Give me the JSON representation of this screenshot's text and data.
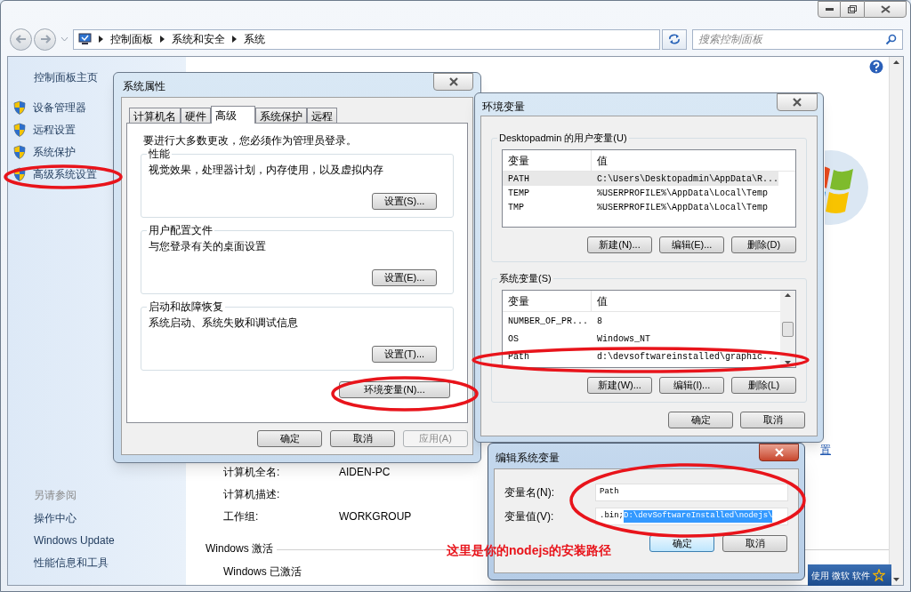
{
  "address_bar": {
    "crumbs": [
      "控制面板",
      "系统和安全",
      "系统"
    ]
  },
  "search": {
    "placeholder": "搜索控制面板"
  },
  "sidebar": {
    "home": "控制面板主页",
    "items": [
      "设备管理器",
      "远程设置",
      "系统保护",
      "高级系统设置"
    ],
    "see_also_title": "另请参阅",
    "see_also": [
      "操作中心",
      "Windows Update",
      "性能信息和工具"
    ]
  },
  "content": {
    "rows": [
      {
        "label": "计算机全名:",
        "value": "AIDEN-PC"
      },
      {
        "label": "计算机描述:"
      },
      {
        "label": "工作组:",
        "value": "WORKGROUP"
      }
    ],
    "activation": {
      "heading": "Windows 激活",
      "status": "Windows 已激活"
    },
    "partial_link": "置",
    "badge": [
      "使用",
      "微软",
      "软件"
    ]
  },
  "system_properties": {
    "title": "系统属性",
    "tabs": [
      {
        "label": "计算机名",
        "selected": false
      },
      {
        "label": "硬件",
        "selected": false
      },
      {
        "label": "高级",
        "selected": true
      },
      {
        "label": "系统保护",
        "selected": false
      },
      {
        "label": "远程",
        "selected": false
      }
    ],
    "notice": "要进行大多数更改，您必须作为管理员登录。",
    "groups": [
      {
        "title": "性能",
        "description": "视觉效果，处理器计划，内存使用，以及虚拟内存",
        "button": "设置(S)..."
      },
      {
        "title": "用户配置文件",
        "description": "与您登录有关的桌面设置",
        "button": "设置(E)..."
      },
      {
        "title": "启动和故障恢复",
        "description": "系统启动、系统失败和调试信息",
        "button": "设置(T)..."
      }
    ],
    "env_button": "环境变量(N)...",
    "buttons": [
      {
        "label": "确定",
        "disabled": false
      },
      {
        "label": "取消",
        "disabled": false
      },
      {
        "label": "应用(A)",
        "disabled": true
      }
    ]
  },
  "environment_variables": {
    "title": "环境变量",
    "user_group": {
      "title": "Desktopadmin 的用户变量(U)",
      "columns": [
        "变量",
        "值"
      ],
      "rows": [
        {
          "name": "PATH",
          "value": "C:\\Users\\Desktopadmin\\AppData\\R...",
          "selected": true
        },
        {
          "name": "TEMP",
          "value": "%USERPROFILE%\\AppData\\Local\\Temp",
          "selected": false
        },
        {
          "name": "TMP",
          "value": "%USERPROFILE%\\AppData\\Local\\Temp",
          "selected": false
        }
      ],
      "buttons": [
        "新建(N)...",
        "编辑(E)...",
        "删除(D)"
      ]
    },
    "system_group": {
      "title": "系统变量(S)",
      "columns": [
        "变量",
        "值"
      ],
      "rows": [
        {
          "name": "NUMBER_OF_PR...",
          "value": "8",
          "selected": false
        },
        {
          "name": "OS",
          "value": "Windows_NT",
          "selected": false
        },
        {
          "name": "Path",
          "value": "d:\\devsoftwareinstalled\\graphic...",
          "selected": false
        }
      ],
      "buttons": [
        "新建(W)...",
        "编辑(I)...",
        "删除(L)"
      ]
    },
    "buttons": [
      "确定",
      "取消"
    ]
  },
  "edit_dialog": {
    "title": "编辑系统变量",
    "fields": [
      {
        "label": "变量名(N):",
        "value": "Path"
      },
      {
        "label": "变量值(V):",
        "value": ".bin;",
        "selection": "D:\\devSoftwareInstalled\\nodejs\\"
      }
    ],
    "buttons": [
      {
        "label": "确定",
        "default": true
      },
      {
        "label": "取消",
        "default": false
      }
    ]
  },
  "annotation": {
    "text": "这里是你的nodejs的安装路径"
  }
}
